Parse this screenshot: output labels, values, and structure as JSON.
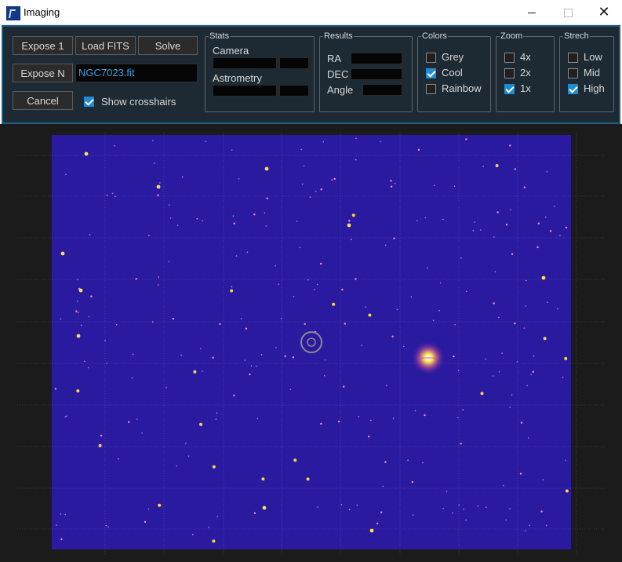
{
  "window": {
    "title": "Imaging",
    "icon": "telescope-app-icon"
  },
  "toolbar": {
    "expose1_label": "Expose 1",
    "load_fits_label": "Load FITS",
    "solve_label": "Solve",
    "exposeN_label": "Expose N",
    "file_value": "NGC7023.fit",
    "cancel_label": "Cancel",
    "crosshairs_label": "Show crosshairs",
    "crosshairs_checked": true
  },
  "stats": {
    "title": "Stats",
    "camera_label": "Camera",
    "astrometry_label": "Astrometry"
  },
  "results": {
    "title": "Results",
    "ra_label": "RA",
    "dec_label": "DEC",
    "angle_label": "Angle"
  },
  "colors": {
    "title": "Colors",
    "options": [
      {
        "label": "Grey",
        "checked": false
      },
      {
        "label": "Cool",
        "checked": true
      },
      {
        "label": "Rainbow",
        "checked": false
      }
    ]
  },
  "zoom": {
    "title": "Zoom",
    "options": [
      {
        "label": "4x",
        "checked": false
      },
      {
        "label": "2x",
        "checked": false
      },
      {
        "label": "1x",
        "checked": true
      }
    ]
  },
  "stretch": {
    "title": "Strech",
    "options": [
      {
        "label": "Low",
        "checked": false
      },
      {
        "label": "Mid",
        "checked": false
      },
      {
        "label": "High",
        "checked": true
      }
    ]
  },
  "theme": {
    "panel_bg": "#1d2a34",
    "panel_border": "#1f5f80",
    "accent": "#1e8bd3",
    "image_bg": "#2a1aa0",
    "viewer_bg": "#1b1b1b"
  }
}
